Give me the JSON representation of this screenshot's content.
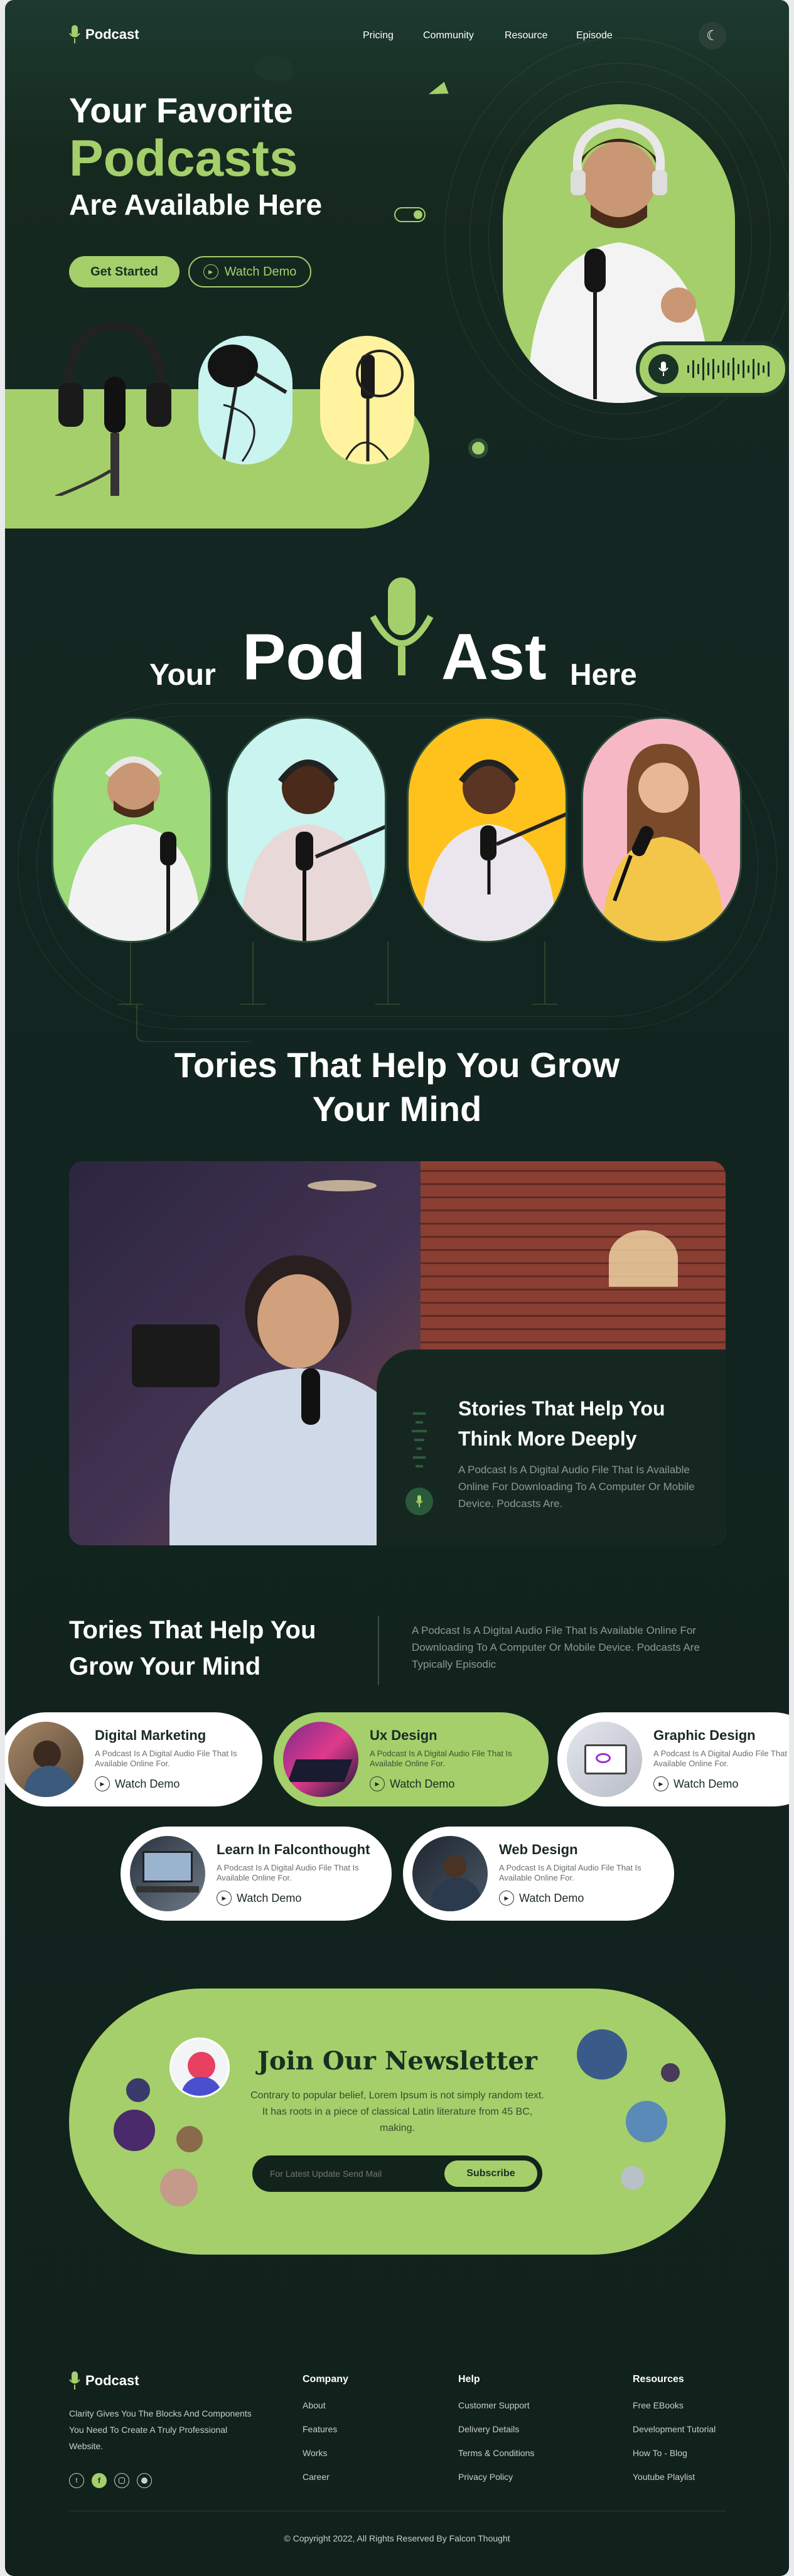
{
  "nav": {
    "brand": "Podcast",
    "links": [
      "Pricing",
      "Community",
      "Resource",
      "Episode"
    ]
  },
  "hero": {
    "line1": "Your Favorite",
    "line2": "Podcasts",
    "line3": "Are Available Here",
    "cta_primary": "Get Started",
    "cta_secondary": "Watch Demo"
  },
  "podcast_title": {
    "left": "Your",
    "pod": "Pod",
    "ast": "Ast",
    "right": "Here"
  },
  "stories": {
    "title_line1": "Tories That Help You Grow",
    "title_line2": "Your Mind",
    "card_title_line1": "Stories That Help You",
    "card_title_line2": "Think More Deeply",
    "card_text": "A Podcast Is A Digital Audio File That Is Available Online For Downloading To A Computer Or Mobile Device. Podcasts Are."
  },
  "categories": {
    "title_line1": "Tories That Help You",
    "title_line2": "Grow Your Mind",
    "intro": "A Podcast Is A Digital Audio File That Is Available Online For Downloading To A Computer Or Mobile Device. Podcasts Are Typically Episodic",
    "items": [
      {
        "title": "Digital Marketing",
        "desc": "A Podcast Is A Digital Audio File That Is Available Online For.",
        "action": "Watch Demo"
      },
      {
        "title": "Ux Design",
        "desc": "A Podcast Is A Digital Audio File That Is Available Online For.",
        "action": "Watch Demo"
      },
      {
        "title": "Graphic Design",
        "desc": "A Podcast Is A Digital Audio File That Is Available Online For.",
        "action": "Watch Demo"
      },
      {
        "title": "Learn In Falconthought",
        "desc": "A Podcast Is A Digital Audio File That Is Available Online For.",
        "action": "Watch Demo"
      },
      {
        "title": "Web Design",
        "desc": "A Podcast Is A Digital Audio File That Is Available Online For.",
        "action": "Watch Demo"
      }
    ]
  },
  "newsletter": {
    "title": "Join Our Newsletter",
    "text": "Contrary to popular belief, Lorem Ipsum is not simply random text. It has roots in a piece of classical Latin literature from 45 BC, making.",
    "placeholder": "For Latest Update Send Mail",
    "button": "Subscribe"
  },
  "footer": {
    "brand": "Podcast",
    "about": "Clarity Gives You The Blocks And Components You Need To Create A Truly Professional Website.",
    "social_icons": [
      "twitter-icon",
      "facebook-icon",
      "instagram-icon",
      "github-icon"
    ],
    "columns": [
      {
        "title": "Company",
        "links": [
          "About",
          "Features",
          "Works",
          "Career"
        ]
      },
      {
        "title": "Help",
        "links": [
          "Customer Support",
          "Delivery Details",
          "Terms & Conditions",
          "Privacy Policy"
        ]
      },
      {
        "title": "Resources",
        "links": [
          "Free EBooks",
          "Development Tutorial",
          "How To - Blog",
          "Youtube Playlist"
        ]
      }
    ],
    "copyright": "© Copyright 2022, All Rights Reserved By Falcon Thought"
  },
  "colors": {
    "accent": "#a4cf6b",
    "background": "#13261f",
    "yellow": "#ffc21d",
    "pink": "#f7b8c6",
    "cyan": "#c9f4f0"
  }
}
